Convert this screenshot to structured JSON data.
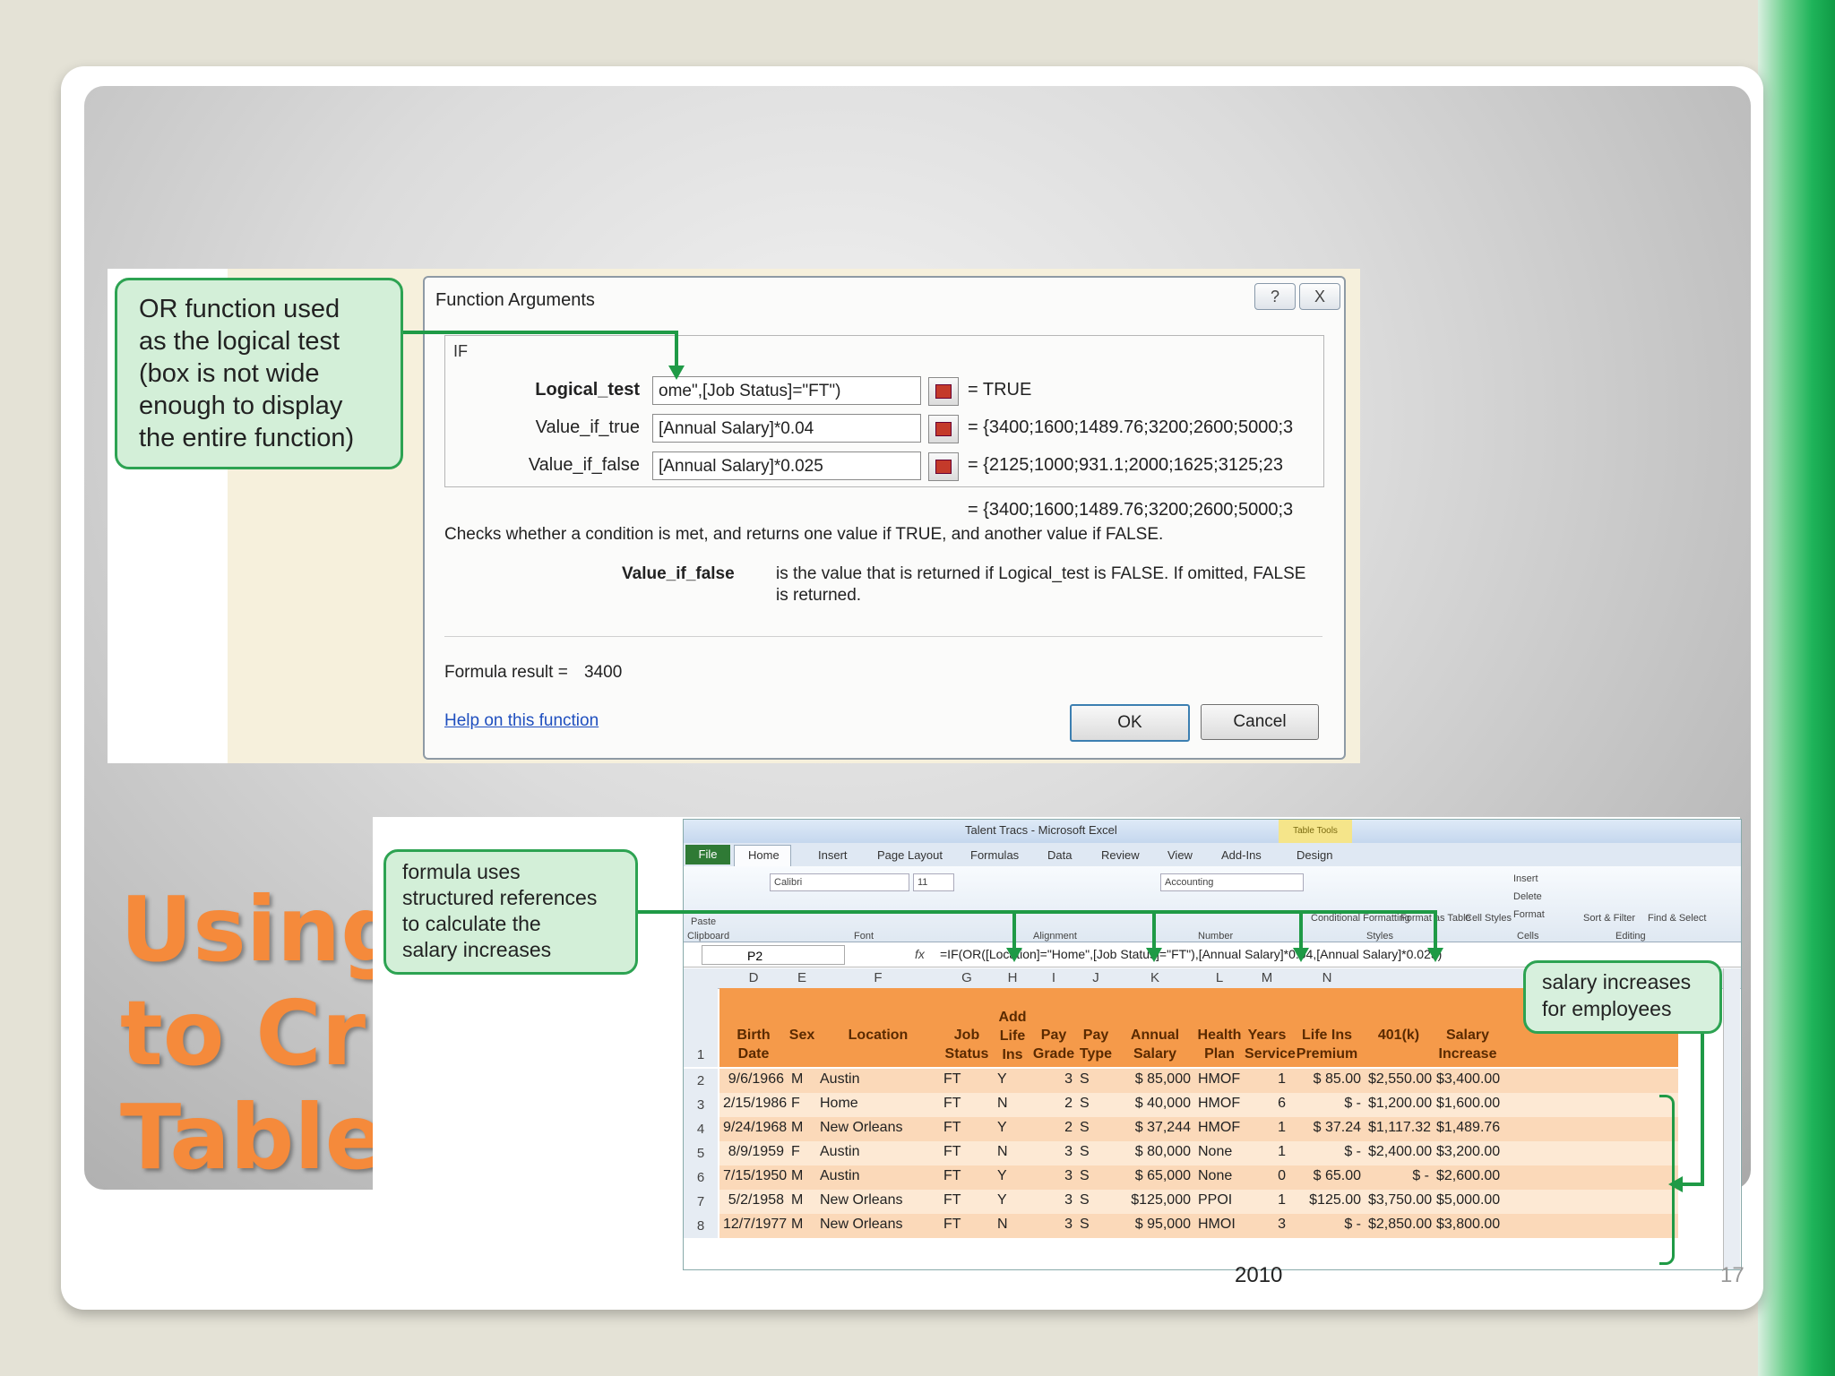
{
  "slide": {
    "title_lines": [
      "Using",
      "to Cr",
      "Table"
    ],
    "year": "2010",
    "slide_number": "17"
  },
  "dialog": {
    "title": "Function Arguments",
    "help_glyph": "?",
    "close_glyph": "X",
    "function_name": "IF",
    "args": [
      {
        "label": "Logical_test",
        "value": "ome\",[Job Status]=\"FT\")",
        "result": "=  TRUE"
      },
      {
        "label": "Value_if_true",
        "value": "[Annual Salary]*0.04",
        "result": "=  {3400;1600;1489.76;3200;2600;5000;3"
      },
      {
        "label": "Value_if_false",
        "value": "[Annual Salary]*0.025",
        "result": "=  {2125;1000;931.1;2000;1625;3125;23"
      }
    ],
    "overall_result": "=  {3400;1600;1489.76;3200;2600;5000;3",
    "description": "Checks whether a condition is met, and returns one value if TRUE, and another value if FALSE.",
    "param_name": "Value_if_false",
    "param_desc_1": "is the value that is returned if Logical_test is FALSE. If omitted, FALSE",
    "param_desc_2": "is returned.",
    "formula_result_label": "Formula result =",
    "formula_result_value": "3400",
    "help_link": "Help on this function",
    "ok_label": "OK",
    "cancel_label": "Cancel"
  },
  "callouts": {
    "or_function": [
      "OR  function used",
      "as the logical test",
      "(box is not wide",
      "enough to display",
      "the entire function)"
    ],
    "formula_uses": [
      "formula uses",
      "structured references",
      "to calculate the",
      "salary increases"
    ],
    "salary_increases": [
      "salary increases",
      "for employees"
    ]
  },
  "excel": {
    "title": "Talent Tracs - Microsoft Excel",
    "table_tools": "Table Tools",
    "tabs": [
      "File",
      "Home",
      "Insert",
      "Page Layout",
      "Formulas",
      "Data",
      "Review",
      "View",
      "Add-Ins",
      "Design"
    ],
    "ribbon": {
      "font_name": "Calibri",
      "font_size": "11",
      "number_format": "Accounting",
      "paste": "Paste",
      "groups": [
        "Clipboard",
        "Font",
        "Alignment",
        "Number",
        "Styles",
        "Cells",
        "Editing"
      ],
      "conditional": "Conditional Formatting",
      "format_table": "Format as Table",
      "cell_styles": "Cell Styles",
      "insert": "Insert",
      "delete": "Delete",
      "format": "Format",
      "sort": "Sort & Filter",
      "find": "Find & Select"
    },
    "name_box": "P2",
    "fx": "fx",
    "formula": "=IF(OR([Location]=\"Home\",[Job Status]=\"FT\"),[Annual Salary]*0.04,[Annual Salary]*0.025)",
    "columns": [
      "D",
      "E",
      "F",
      "G",
      "H",
      "I",
      "J",
      "K",
      "L",
      "M",
      "N",
      "",
      ""
    ],
    "headers": [
      "Birth Date",
      "Sex",
      "Location",
      "Job Status",
      "Add Life Ins",
      "Pay Grade",
      "Pay Type",
      "Annual Salary",
      "Health Plan",
      "Years Service",
      "Life Ins Premium",
      "401(k)",
      "Salary Increase"
    ],
    "rows": [
      {
        "n": "2",
        "cells": [
          "9/6/1966",
          "M",
          "Austin",
          "FT",
          "Y",
          "3",
          "S",
          "$  85,000",
          "HMOF",
          "1",
          "$  85.00",
          "$2,550.00",
          "$3,400.00"
        ]
      },
      {
        "n": "3",
        "cells": [
          "2/15/1986",
          "F",
          "Home",
          "FT",
          "N",
          "2",
          "S",
          "$  40,000",
          "HMOF",
          "6",
          "$      -",
          "$1,200.00",
          "$1,600.00"
        ]
      },
      {
        "n": "4",
        "cells": [
          "9/24/1968",
          "M",
          "New Orleans",
          "FT",
          "Y",
          "2",
          "S",
          "$  37,244",
          "HMOF",
          "1",
          "$  37.24",
          "$1,117.32",
          "$1,489.76"
        ]
      },
      {
        "n": "5",
        "cells": [
          "8/9/1959",
          "F",
          "Austin",
          "FT",
          "N",
          "3",
          "S",
          "$  80,000",
          "None",
          "1",
          "$      -",
          "$2,400.00",
          "$3,200.00"
        ]
      },
      {
        "n": "6",
        "cells": [
          "7/15/1950",
          "M",
          "Austin",
          "FT",
          "Y",
          "3",
          "S",
          "$  65,000",
          "None",
          "0",
          "$  65.00",
          "$      -",
          "$2,600.00"
        ]
      },
      {
        "n": "7",
        "cells": [
          "5/2/1958",
          "M",
          "New Orleans",
          "FT",
          "Y",
          "3",
          "S",
          "$125,000",
          "PPOI",
          "1",
          "$125.00",
          "$3,750.00",
          "$5,000.00"
        ]
      },
      {
        "n": "8",
        "cells": [
          "12/7/1977",
          "M",
          "New Orleans",
          "FT",
          "N",
          "3",
          "S",
          "$  95,000",
          "HMOI",
          "3",
          "$      -",
          "$2,850.00",
          "$3,800.00"
        ]
      }
    ]
  }
}
